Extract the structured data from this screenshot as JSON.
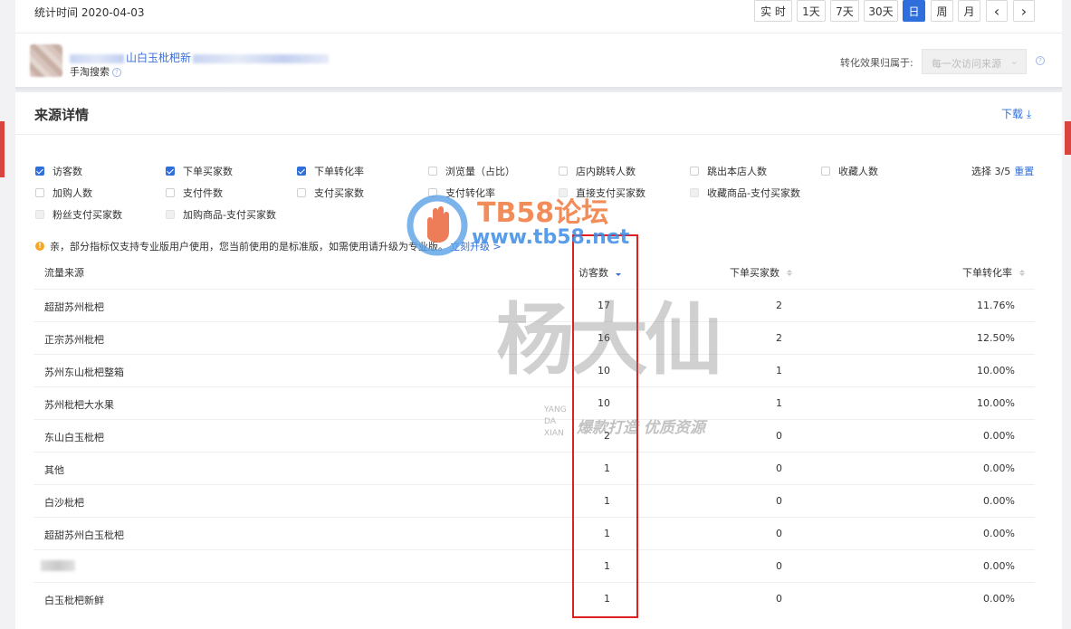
{
  "header": {
    "stat_time": "统计时间 2020-04-03",
    "periods": [
      "实 时",
      "1天",
      "7天",
      "30天",
      "日",
      "周",
      "月"
    ],
    "active_period": "日",
    "prev": "‹",
    "next": "›"
  },
  "shop": {
    "name_visible": "山白玉枇杷新",
    "subtitle": "手淘搜索",
    "attribution_label": "转化效果归属于:",
    "attribution_value": "每一次访问来源"
  },
  "panel": {
    "title": "来源详情",
    "download_label": "下载"
  },
  "metrics": [
    {
      "label": "访客数",
      "state": "checked"
    },
    {
      "label": "下单买家数",
      "state": "checked"
    },
    {
      "label": "下单转化率",
      "state": "checked"
    },
    {
      "label": "浏览量（占比）",
      "state": "unchecked"
    },
    {
      "label": "店内跳转人数",
      "state": "unchecked"
    },
    {
      "label": "跳出本店人数",
      "state": "unchecked"
    },
    {
      "label": "收藏人数",
      "state": "unchecked"
    },
    {
      "label": "加购人数",
      "state": "unchecked"
    },
    {
      "label": "支付件数",
      "state": "unchecked"
    },
    {
      "label": "支付买家数",
      "state": "unchecked"
    },
    {
      "label": "支付转化率",
      "state": "unchecked"
    },
    {
      "label": "直接支付买家数",
      "state": "disabled"
    },
    {
      "label": "收藏商品-支付买家数",
      "state": "disabled"
    },
    {
      "label": "粉丝支付买家数",
      "state": "disabled"
    },
    {
      "label": "加购商品-支付买家数",
      "state": "disabled"
    }
  ],
  "selection": {
    "count_text": "选择 3/5",
    "reset_label": "重置"
  },
  "notice": {
    "icon": "!",
    "text": "亲，部分指标仅支持专业版用户使用，您当前使用的是标准版，如需使用请升级为专业版。",
    "link": "立刻升级 >"
  },
  "table": {
    "columns": [
      "流量来源",
      "访客数",
      "下单买家数",
      "下单转化率"
    ],
    "rows": [
      {
        "source": "超甜苏州枇杷",
        "visitors": "17",
        "buyers": "2",
        "rate": "11.76%"
      },
      {
        "source": "正宗苏州枇杷",
        "visitors": "16",
        "buyers": "2",
        "rate": "12.50%"
      },
      {
        "source": "苏州东山枇杷整箱",
        "visitors": "10",
        "buyers": "1",
        "rate": "10.00%"
      },
      {
        "source": "苏州枇杷大水果",
        "visitors": "10",
        "buyers": "1",
        "rate": "10.00%"
      },
      {
        "source": "东山白玉枇杷",
        "visitors": "2",
        "buyers": "0",
        "rate": "0.00%"
      },
      {
        "source": "其他",
        "visitors": "1",
        "buyers": "0",
        "rate": "0.00%"
      },
      {
        "source": "白沙枇杷",
        "visitors": "1",
        "buyers": "0",
        "rate": "0.00%"
      },
      {
        "source": "超甜苏州白玉枇杷",
        "visitors": "1",
        "buyers": "0",
        "rate": "0.00%"
      },
      {
        "source": "",
        "visitors": "1",
        "buyers": "0",
        "rate": "0.00%"
      },
      {
        "source": "白玉枇杷新鲜",
        "visitors": "1",
        "buyers": "0",
        "rate": "0.00%"
      }
    ]
  },
  "watermark": {
    "title": "TB58论坛",
    "url": "www.tb58.net",
    "calligraphy": "杨大仙",
    "pinyin": [
      "YANG",
      "DA",
      "XIAN"
    ],
    "slogan": "爆款打造 优质资源"
  },
  "colors": {
    "accent": "#2f6fdc",
    "highlight_box": "#e02020",
    "warning": "#f5a623"
  }
}
